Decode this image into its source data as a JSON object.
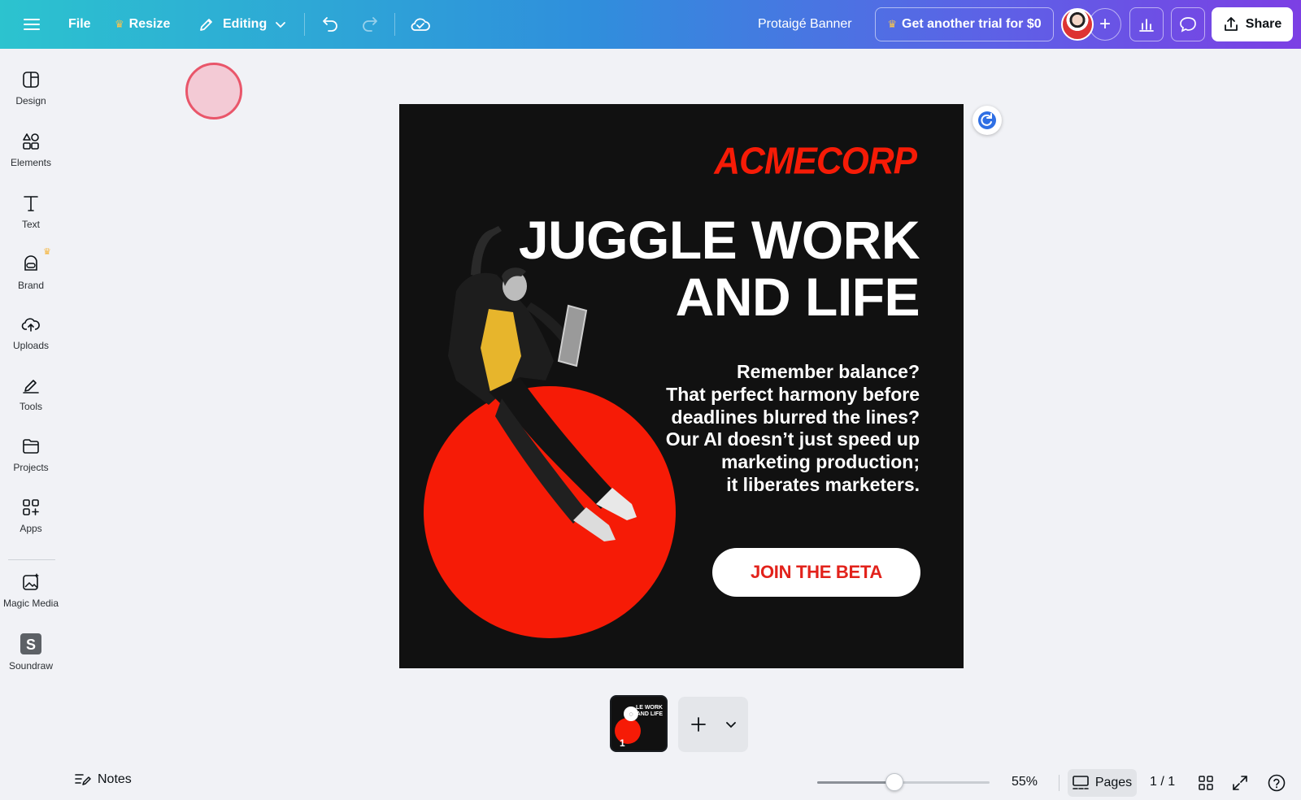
{
  "topbar": {
    "file_label": "File",
    "resize_label": "Resize",
    "editing_label": "Editing",
    "doc_title": "Protaigé Banner",
    "trial_label": "Get another trial for $0",
    "share_label": "Share"
  },
  "sidebar": {
    "items": [
      {
        "label": "Design",
        "icon": "design-icon"
      },
      {
        "label": "Elements",
        "icon": "elements-icon"
      },
      {
        "label": "Text",
        "icon": "text-icon"
      },
      {
        "label": "Brand",
        "icon": "brand-icon"
      },
      {
        "label": "Uploads",
        "icon": "uploads-icon"
      },
      {
        "label": "Tools",
        "icon": "tools-icon"
      },
      {
        "label": "Projects",
        "icon": "projects-icon"
      },
      {
        "label": "Apps",
        "icon": "apps-icon"
      },
      {
        "label": "Magic Media",
        "icon": "magic-media-icon"
      },
      {
        "label": "Soundraw",
        "icon": "soundraw-icon"
      }
    ]
  },
  "design": {
    "logo": "ACMECORP",
    "headline_line1": "JUGGLE WORK",
    "headline_line2": "AND LIFE",
    "body_lines": [
      "Remember balance?",
      "That perfect harmony before",
      "deadlines blurred the lines?",
      "Our AI doesn’t just speed up",
      "marketing production;",
      "it liberates marketers."
    ],
    "cta_label": "JOIN THE BETA",
    "colors": {
      "background": "#111111",
      "accent": "#f61b06",
      "text": "#ffffff"
    }
  },
  "thumbnail": {
    "page_number": "1",
    "mini_headline_1": "LE WORK",
    "mini_headline_2": "AND LIFE"
  },
  "bottombar": {
    "notes_label": "Notes",
    "zoom_level": "55%",
    "zoom_fraction": 0.45,
    "pages_label": "Pages",
    "page_count": "1 / 1"
  },
  "colors": {
    "topbar_gradient_start": "#2cc3cf",
    "topbar_gradient_end": "#7c3fe4",
    "workspace": "#f1f2f6",
    "crown": "#f5c451"
  }
}
